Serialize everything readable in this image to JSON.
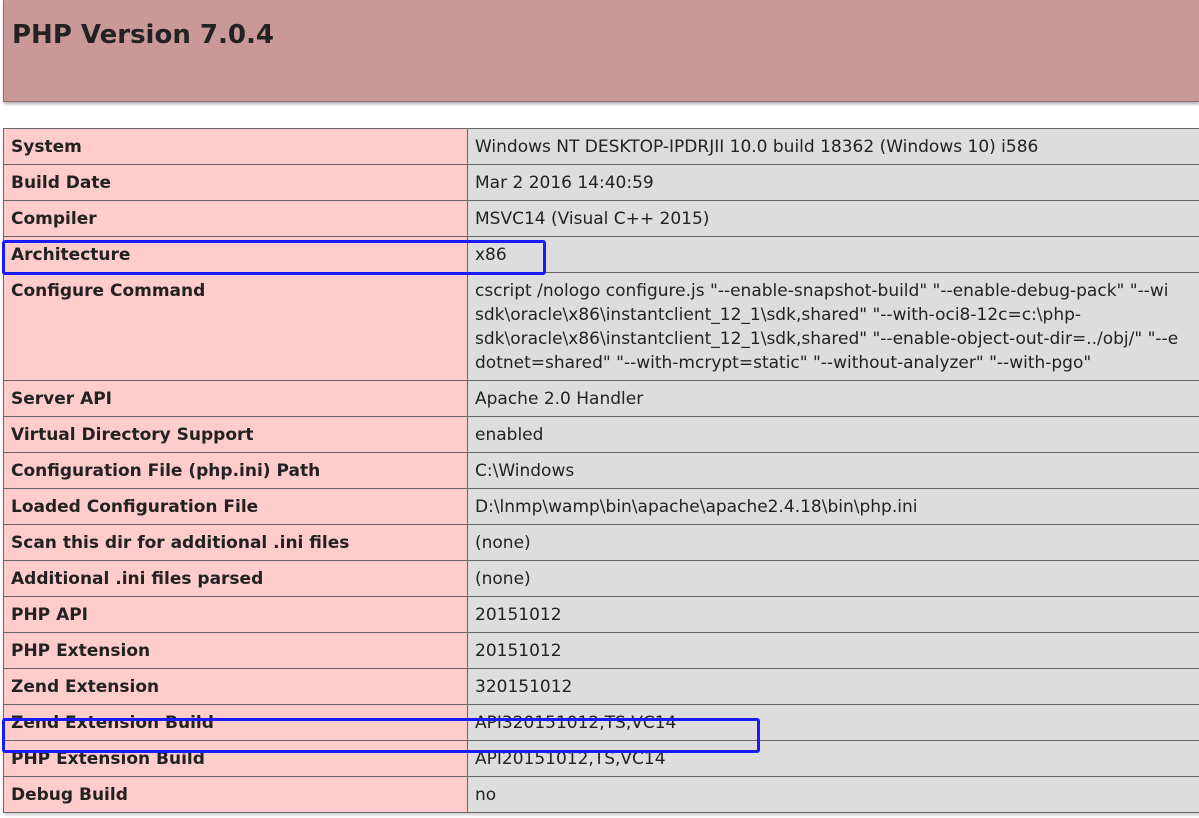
{
  "page": {
    "title": "PHP Version 7.0.4"
  },
  "info_rows": [
    {
      "key": "System",
      "value": "Windows NT DESKTOP-IPDRJII 10.0 build 18362 (Windows 10) i586"
    },
    {
      "key": "Build Date",
      "value": "Mar 2 2016 14:40:59"
    },
    {
      "key": "Compiler",
      "value": "MSVC14 (Visual C++ 2015)"
    },
    {
      "key": "Architecture",
      "value": "x86"
    },
    {
      "key": "Configure Command",
      "value": "cscript /nologo configure.js \"--enable-snapshot-build\" \"--enable-debug-pack\" \"--wi"
    },
    {
      "key": "Server API",
      "value": "Apache 2.0 Handler"
    },
    {
      "key": "Virtual Directory Support",
      "value": "enabled"
    },
    {
      "key": "Configuration File (php.ini) Path",
      "value": "C:\\Windows"
    },
    {
      "key": "Loaded Configuration File",
      "value": "D:\\lnmp\\wamp\\bin\\apache\\apache2.4.18\\bin\\php.ini"
    },
    {
      "key": "Scan this dir for additional .ini files",
      "value": "(none)"
    },
    {
      "key": "Additional .ini files parsed",
      "value": "(none)"
    },
    {
      "key": "PHP API",
      "value": "20151012"
    },
    {
      "key": "PHP Extension",
      "value": "20151012"
    },
    {
      "key": "Zend Extension",
      "value": "320151012"
    },
    {
      "key": "Zend Extension Build",
      "value": "API320151012,TS,VC14"
    },
    {
      "key": "PHP Extension Build",
      "value": "API20151012,TS,VC14"
    },
    {
      "key": "Debug Build",
      "value": "no"
    }
  ],
  "configure_command_lines": [
    "cscript /nologo configure.js \"--enable-snapshot-build\" \"--enable-debug-pack\" \"--wi",
    "sdk\\oracle\\x86\\instantclient_12_1\\sdk,shared\" \"--with-oci8-12c=c:\\php-",
    "sdk\\oracle\\x86\\instantclient_12_1\\sdk,shared\" \"--enable-object-out-dir=../obj/\" \"--e",
    "dotnet=shared\" \"--with-mcrypt=static\" \"--without-analyzer\" \"--with-pgo\""
  ],
  "annotations": {
    "highlight_color": "#1a1aff",
    "highlighted_rows": [
      "Architecture",
      "Zend Extension Build"
    ]
  },
  "colors": {
    "header_bg": "#c99897",
    "key_bg": "#ffcccc",
    "value_bg": "#dddddd"
  }
}
